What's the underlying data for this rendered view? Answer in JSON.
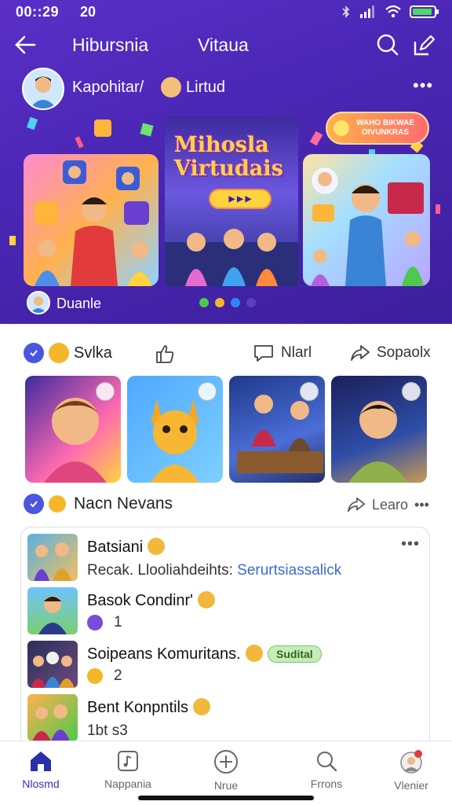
{
  "status_bar": {
    "time": "00::29",
    "extra": "20"
  },
  "nav": {
    "title_left": "Hibursnia",
    "title_right": "Vitaua"
  },
  "profile": {
    "name": "Kapohitar/",
    "tag": "Lirtud"
  },
  "carousel": {
    "title": "Mihosla Virtudais",
    "promo_text": "WAHO BIKWAE OIVUNKRAS"
  },
  "hero_footer": {
    "name": "Duanle"
  },
  "dots": {
    "colors": [
      "#4ec94e",
      "#f5b72a",
      "#2f86f6",
      "#5a3fc0"
    ]
  },
  "reactions": {
    "left_label": "Svlka",
    "comment_label": "Nlarl",
    "share_label": "Sopaolx"
  },
  "section": {
    "title": "Nacn Nevans",
    "learn_label": "Learo"
  },
  "list": {
    "items": [
      {
        "title": "Batsiani",
        "subtitle_prefix": "Recak. Llooliahdeihts:",
        "subtitle_link": "Serurtsiassalick"
      },
      {
        "title": "Basok Condinr'",
        "count": "1"
      },
      {
        "title": "Soipeans Komuritans.",
        "pill": "Sudital",
        "count": "2"
      },
      {
        "title": "Bent Konpntils",
        "subtitle": "1bt s3"
      }
    ]
  },
  "bottom_nav": {
    "items": [
      {
        "label": "Nlosmd"
      },
      {
        "label": "Nappania"
      },
      {
        "label": "Nrue"
      },
      {
        "label": "Frrons"
      },
      {
        "label": "Vlenier"
      }
    ]
  },
  "colors": {
    "brand_purple": "#4b27b5",
    "accent_blue": "#3a6bd8",
    "active_nav": "#3b2fb0"
  }
}
